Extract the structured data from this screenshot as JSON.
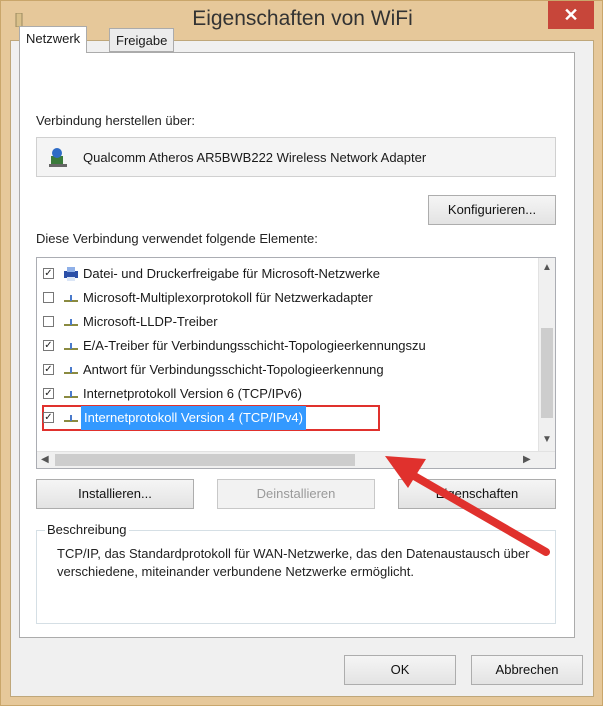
{
  "window": {
    "title": "Eigenschaften von WiFi",
    "close_label": "✕"
  },
  "tabs": [
    {
      "label": "Netzwerk",
      "active": true
    },
    {
      "label": "Freigabe",
      "active": false
    }
  ],
  "connect_label": "Verbindung herstellen über:",
  "adapter_name": "Qualcomm Atheros AR5BWB222 Wireless Network Adapter",
  "configure_button": "Konfigurieren...",
  "elements_label": "Diese Verbindung verwendet folgende Elemente:",
  "items": [
    {
      "label": "Datei- und Druckerfreigabe für Microsoft-Netzwerke",
      "checked": true,
      "icon": "printer-icon"
    },
    {
      "label": "Microsoft-Multiplexorprotokoll für Netzwerkadapter",
      "checked": false,
      "icon": "protocol-icon"
    },
    {
      "label": "Microsoft-LLDP-Treiber",
      "checked": false,
      "icon": "protocol-icon"
    },
    {
      "label": "E/A-Treiber für Verbindungsschicht-Topologieerkennungszu",
      "checked": true,
      "icon": "protocol-icon"
    },
    {
      "label": "Antwort für Verbindungsschicht-Topologieerkennung",
      "checked": true,
      "icon": "protocol-icon"
    },
    {
      "label": "Internetprotokoll Version 6 (TCP/IPv6)",
      "checked": true,
      "icon": "protocol-icon"
    },
    {
      "label": "Internetprotokoll Version 4 (TCP/IPv4)",
      "checked": true,
      "icon": "protocol-icon",
      "selected": true
    }
  ],
  "buttons": {
    "install": "Installieren...",
    "uninstall": "Deinstallieren",
    "properties": "Eigenschaften"
  },
  "description": {
    "legend": "Beschreibung",
    "text": "TCP/IP, das Standardprotokoll für WAN-Netzwerke, das den Datenaustausch über verschiedene, miteinander verbundene Netzwerke ermöglicht."
  },
  "footer": {
    "ok": "OK",
    "cancel": "Abbrechen"
  },
  "colors": {
    "selection": "#3399ff",
    "highlight_outline": "#e0312d",
    "annotation_arrow": "#e0312d",
    "close_button": "#c7463a"
  }
}
